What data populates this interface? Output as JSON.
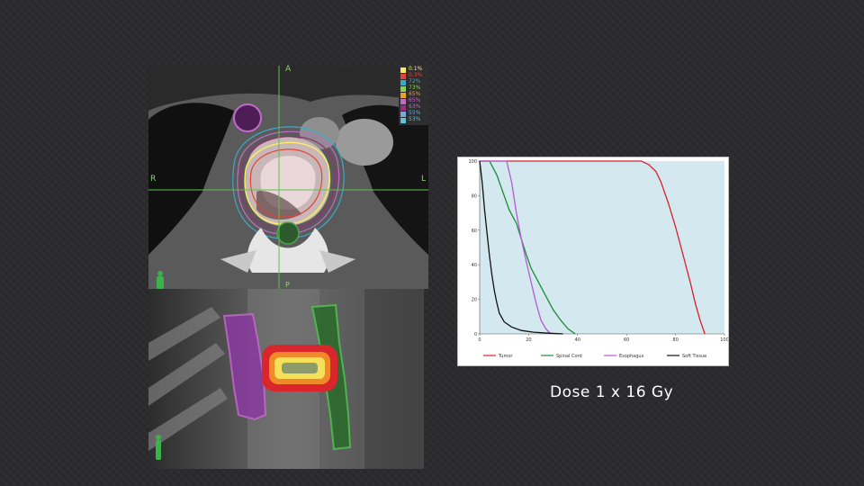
{
  "caption": "Dose 1 x 16 Gy",
  "ct_axial": {
    "orientation_labels": {
      "anterior": "A",
      "right": "R",
      "left": "L",
      "posterior": "P"
    },
    "isodose_legend": [
      {
        "label": "0.1%",
        "color": "#f5e96a"
      },
      {
        "label": "0.3%",
        "color": "#e2433a"
      },
      {
        "label": "72%",
        "color": "#3fa7c9"
      },
      {
        "label": "73%",
        "color": "#8bd05a"
      },
      {
        "label": "65%",
        "color": "#e8a323"
      },
      {
        "label": "65%",
        "color": "#c06bc8"
      },
      {
        "label": "63%",
        "color": "#9a2d7a"
      },
      {
        "label": "55%",
        "color": "#7aa7d8"
      },
      {
        "label": "53%",
        "color": "#5fc2d9"
      }
    ]
  },
  "sagittal": {},
  "chart_data": {
    "type": "line",
    "title": "",
    "xlabel": "",
    "ylabel": "",
    "xlim": [
      0,
      100
    ],
    "ylim": [
      0,
      100
    ],
    "x_ticks": [
      "0",
      "20",
      "40",
      "60",
      "80",
      "100"
    ],
    "y_ticks": [
      "100",
      "80",
      "60",
      "40",
      "20",
      "0"
    ],
    "grid": false,
    "legend_placement": "bottom",
    "series": [
      {
        "name": "Tumor",
        "color": "#d8222c",
        "x": [
          0,
          66,
          69,
          72,
          74,
          77,
          80,
          83,
          86,
          88,
          90,
          92
        ],
        "y": [
          100,
          100,
          98,
          94,
          88,
          76,
          62,
          46,
          30,
          18,
          8,
          0
        ]
      },
      {
        "name": "Spinal Cord",
        "color": "#1f8a3a",
        "x": [
          0,
          4,
          7,
          10,
          12,
          15,
          17,
          19,
          21,
          24,
          27,
          30,
          33,
          36,
          39
        ],
        "y": [
          100,
          100,
          92,
          80,
          72,
          64,
          55,
          46,
          38,
          30,
          22,
          14,
          8,
          3,
          0
        ]
      },
      {
        "name": "Esophagus",
        "color": "#b75bd0",
        "x": [
          0,
          11,
          13,
          15,
          17,
          19,
          21,
          23,
          25,
          27,
          29
        ],
        "y": [
          100,
          100,
          88,
          70,
          55,
          42,
          30,
          18,
          8,
          3,
          0
        ]
      },
      {
        "name": "Soft Tissue",
        "color": "#111111",
        "x": [
          0,
          1,
          2,
          3,
          4,
          5,
          6,
          7,
          8,
          10,
          13,
          17,
          22,
          28,
          34
        ],
        "y": [
          100,
          88,
          72,
          58,
          45,
          34,
          25,
          18,
          12,
          7,
          4,
          2,
          1,
          0.4,
          0
        ]
      }
    ]
  }
}
